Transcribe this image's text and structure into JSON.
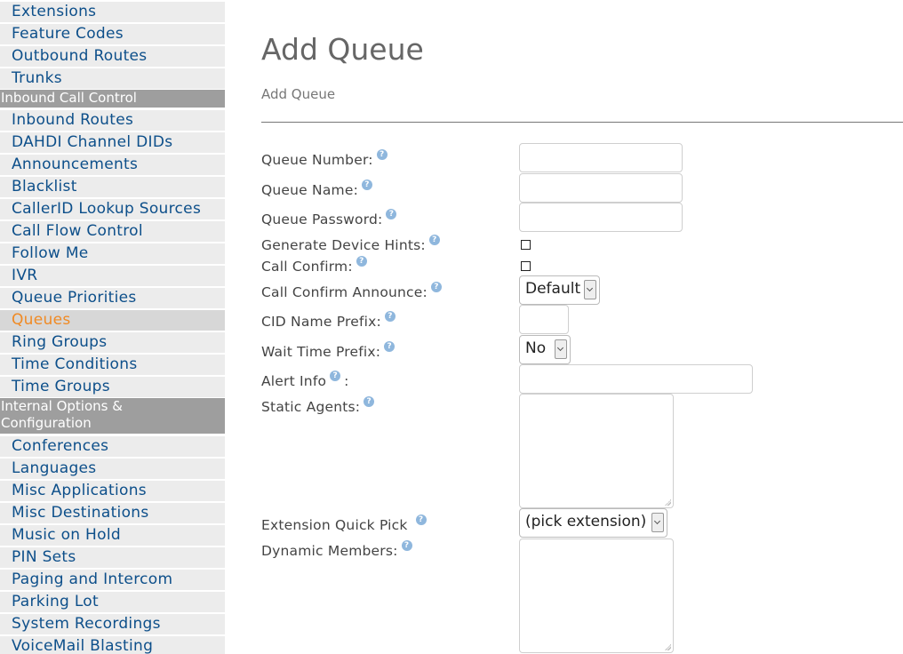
{
  "sidebar": {
    "items": [
      {
        "label": "Extensions",
        "active": false
      },
      {
        "label": "Feature Codes",
        "active": false
      },
      {
        "label": "Outbound Routes",
        "active": false
      },
      {
        "label": "Trunks",
        "active": false
      },
      {
        "label": "Inbound Call Control",
        "header": true
      },
      {
        "label": "Inbound Routes",
        "active": false
      },
      {
        "label": "DAHDI Channel DIDs",
        "active": false
      },
      {
        "label": "Announcements",
        "active": false
      },
      {
        "label": "Blacklist",
        "active": false
      },
      {
        "label": "CallerID Lookup Sources",
        "active": false
      },
      {
        "label": "Call Flow Control",
        "active": false
      },
      {
        "label": "Follow Me",
        "active": false
      },
      {
        "label": "IVR",
        "active": false
      },
      {
        "label": "Queue Priorities",
        "active": false
      },
      {
        "label": "Queues",
        "active": true
      },
      {
        "label": "Ring Groups",
        "active": false
      },
      {
        "label": "Time Conditions",
        "active": false
      },
      {
        "label": "Time Groups",
        "active": false
      },
      {
        "label": "Internal Options & Configuration",
        "header": true
      },
      {
        "label": "Conferences",
        "active": false
      },
      {
        "label": "Languages",
        "active": false
      },
      {
        "label": "Misc Applications",
        "active": false
      },
      {
        "label": "Misc Destinations",
        "active": false
      },
      {
        "label": "Music on Hold",
        "active": false
      },
      {
        "label": "PIN Sets",
        "active": false
      },
      {
        "label": "Paging and Intercom",
        "active": false
      },
      {
        "label": "Parking Lot",
        "active": false
      },
      {
        "label": "System Recordings",
        "active": false
      },
      {
        "label": "VoiceMail Blasting",
        "active": false
      }
    ]
  },
  "main": {
    "title": "Add Queue",
    "subtitle": "Add Queue",
    "form": {
      "queue_number": {
        "label": "Queue Number:",
        "value": ""
      },
      "queue_name": {
        "label": "Queue Name:",
        "value": ""
      },
      "queue_password": {
        "label": "Queue Password:",
        "value": ""
      },
      "device_hints": {
        "label": "Generate Device Hints:",
        "checked": false
      },
      "call_confirm": {
        "label": "Call Confirm:",
        "checked": false
      },
      "confirm_announce": {
        "label": "Call Confirm Announce:",
        "value": "Default"
      },
      "cid_prefix": {
        "label": "CID Name Prefix:",
        "value": ""
      },
      "wait_time_prefix": {
        "label": "Wait Time Prefix:",
        "value": "No"
      },
      "alert_info": {
        "label": "Alert Info",
        "suffix": ":",
        "value": ""
      },
      "static_agents": {
        "label": "Static Agents:",
        "value": ""
      },
      "ext_quick_pick": {
        "label": "Extension Quick Pick",
        "value": "(pick extension)"
      },
      "dynamic_members": {
        "label": "Dynamic Members:",
        "value": ""
      }
    },
    "help_glyph": "?"
  },
  "colors": {
    "nav_link": "#0d4f8a",
    "nav_active": "#f08a24",
    "nav_bg": "#ececec",
    "section_header_bg": "#9e9e9e",
    "help_icon": "#8fb7dd"
  }
}
